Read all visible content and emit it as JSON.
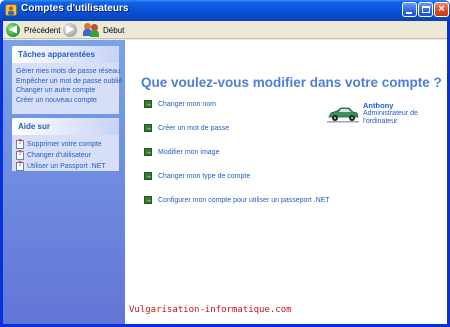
{
  "window": {
    "title": "Comptes d'utilisateurs",
    "close_glyph": "×"
  },
  "toolbar": {
    "back_label": "Précédent",
    "home_label": "Début"
  },
  "sidebar": {
    "related_tasks": {
      "title": "Tâches apparentées",
      "items": [
        "Gérer mes mots de passe réseau",
        "Empêcher un mot de passe oublié",
        "Changer un autre compte",
        "Créer un nouveau compte"
      ]
    },
    "help": {
      "title": "Aide sur",
      "items": [
        "Supprimer votre compte",
        "Changer d'utilisateur",
        "Utiliser un Passport .NET"
      ]
    }
  },
  "main": {
    "title": "Que voulez-vous modifier dans votre compte ?",
    "choices": [
      "Changer mon nom",
      "Créer un mot de passe",
      "Modifier mon image",
      "Changer mon type de compte",
      "Configurer mon compte pour utiliser un passeport .NET"
    ],
    "user": {
      "name": "Anthony",
      "role": "Administrateur de l'ordinateur"
    },
    "watermark": "Vulgarisation-informatique.com"
  },
  "colors": {
    "titlebar": "#0a55d8",
    "link": "#215dc6",
    "heading": "#4f7fd6",
    "sidebar": "#7ba2e7",
    "watermark": "#cc1111"
  },
  "icons": {
    "back": "back-arrow-icon",
    "forward": "forward-arrow-icon",
    "home": "users-icon",
    "task_arrow": "green-arrow-icon",
    "help": "help-icon",
    "user_picture": "car-picture-icon"
  }
}
